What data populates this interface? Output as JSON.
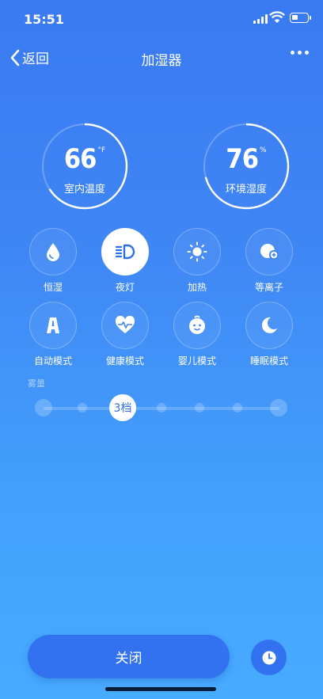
{
  "status_bar": {
    "time": "15:51"
  },
  "nav": {
    "back_label": "返回",
    "title": "加湿器"
  },
  "gauges": [
    {
      "value": "66",
      "unit": "°F",
      "label": "室内温度"
    },
    {
      "value": "76",
      "unit": "%",
      "label": "环境湿度"
    }
  ],
  "modes": [
    {
      "label": "恒湿",
      "icon": "water-drop-icon",
      "active": false
    },
    {
      "label": "夜灯",
      "icon": "headlight-icon",
      "active": true
    },
    {
      "label": "加热",
      "icon": "sun-icon",
      "active": false
    },
    {
      "label": "等离子",
      "icon": "plasma-icon",
      "active": false
    },
    {
      "label": "自动模式",
      "icon": "auto-mode-icon",
      "active": false
    },
    {
      "label": "健康模式",
      "icon": "heart-pulse-icon",
      "active": false
    },
    {
      "label": "婴儿模式",
      "icon": "baby-face-icon",
      "active": false
    },
    {
      "label": "睡眠模式",
      "icon": "moon-icon",
      "active": false
    }
  ],
  "fog": {
    "label": "雾量",
    "level_label": "3档",
    "level": 3,
    "levels": 8
  },
  "actions": {
    "close_label": "关闭",
    "timer_icon": "clock-icon"
  },
  "colors": {
    "accent": "#3271f0",
    "background_top": "#3a7af1",
    "background_bottom": "#47abff"
  }
}
